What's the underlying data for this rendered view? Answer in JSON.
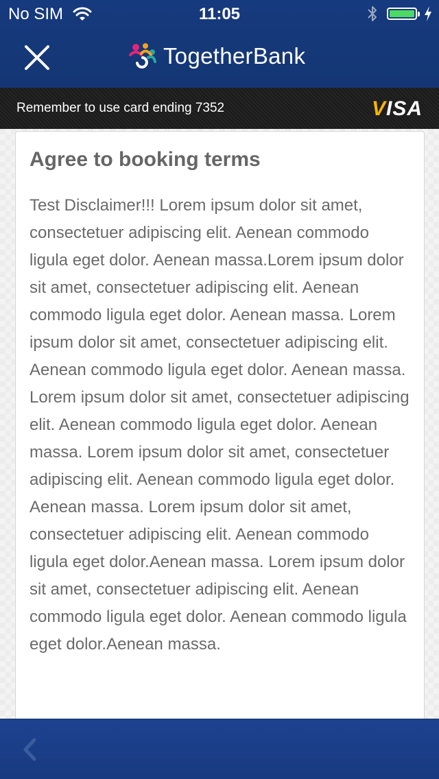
{
  "status_bar": {
    "carrier": "No SIM",
    "time": "11:05",
    "battery_level": 1.0,
    "battery_color": "#4cd964"
  },
  "nav_bar": {
    "close_icon": "close-icon",
    "brand_name": "TogetherBank",
    "brand_logo_colors": [
      "#e5247c",
      "#f7a21b",
      "#2aa6a0",
      "#ffffff"
    ]
  },
  "reminder": {
    "text": "Remember to use card ending 7352",
    "card_brand": "VISA"
  },
  "terms": {
    "title": "Agree to booking terms",
    "body": "Test Disclaimer!!! Lorem ipsum dolor sit amet, consectetuer adipiscing elit. Aenean commodo ligula eget dolor. Aenean massa.Lorem ipsum dolor sit amet, consectetuer adipiscing elit. Aenean commodo ligula eget dolor. Aenean massa. Lorem ipsum dolor sit amet, consectetuer adipiscing elit. Aenean commodo ligula eget dolor. Aenean massa. Lorem ipsum dolor sit amet, consectetuer adipiscing elit. Aenean commodo ligula eget dolor. Aenean massa. Lorem ipsum dolor sit amet, consectetuer adipiscing elit. Aenean commodo ligula eget dolor. Aenean massa. Lorem ipsum dolor sit amet, consectetuer adipiscing elit. Aenean commodo ligula eget dolor.Aenean massa. Lorem ipsum dolor sit amet, consectetuer adipiscing elit. Aenean commodo ligula eget dolor. Aenean commodo ligula eget dolor.Aenean massa."
  },
  "bottom_bar": {
    "back_icon": "chevron-left-icon"
  },
  "colors": {
    "header_blue": "#163a7e",
    "toolbar_blue": "#1e4290",
    "reminder_bg": "#1b1b1b",
    "text_gray": "#6a6a6a",
    "visa_gold": "#f7b600"
  }
}
